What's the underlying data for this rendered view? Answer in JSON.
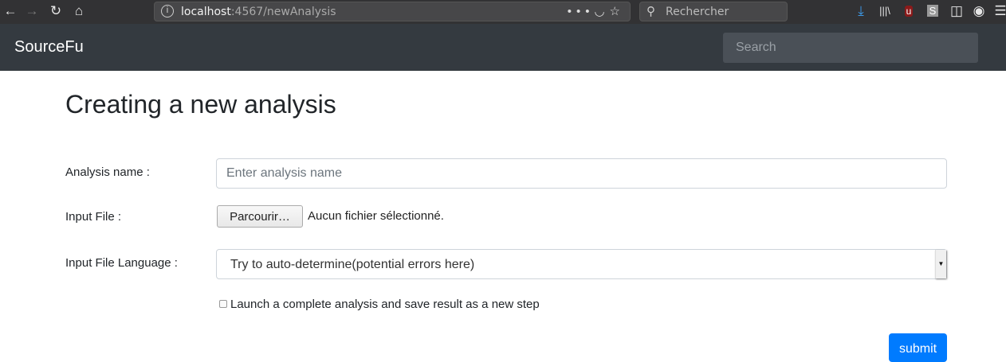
{
  "browser": {
    "url_host": "localhost",
    "url_path": ":4567/newAnalysis",
    "search_placeholder": "Rechercher",
    "accent": "#3d9ae8"
  },
  "navbar": {
    "brand": "SourceFu",
    "search_placeholder": "Search"
  },
  "page": {
    "title": "Creating a new analysis",
    "analysis_name_label": "Analysis name :",
    "analysis_name_placeholder": "Enter analysis name",
    "input_file_label": "Input File :",
    "browse_label": "Parcourir…",
    "no_file_text": "Aucun fichier sélectionné.",
    "language_label": "Input File Language :",
    "language_selected": "Try to auto-determine(potential errors here)",
    "complete_analysis_label": "Launch a complete analysis and save result as a new step",
    "submit_label": "submit",
    "primary_color": "#007bff"
  }
}
